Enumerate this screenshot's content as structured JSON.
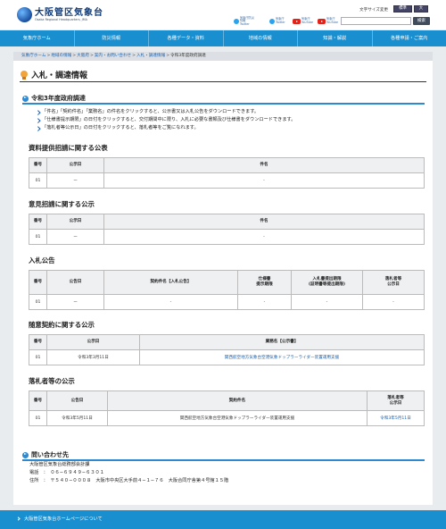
{
  "header": {
    "logo_ja": "大阪管区気象台",
    "logo_en": "Osaka Regional Headquarters, JMA",
    "sns": [
      {
        "icon": "twitter-icon",
        "label": "気象庁防災情報 Twitter"
      },
      {
        "icon": "twitter-icon",
        "label": "気象庁 Twitter"
      },
      {
        "icon": "youtube-icon",
        "label": "気象庁 YouTube"
      },
      {
        "icon": "youtube-icon",
        "label": "気象庁 YouTube"
      }
    ],
    "font_size_label": "文字サイズ変更",
    "font_size_standard": "標準",
    "font_size_large": "大",
    "search_button": "検索"
  },
  "nav": [
    "気象庁ホーム",
    "防災情報",
    "各種データ・資料",
    "地域の情報",
    "知識・解説",
    "各種申請・ご案内"
  ],
  "breadcrumbs": [
    "気象庁ホーム",
    "地域の情報",
    "大阪府",
    "案内・お問い合わせ",
    "入札・調達情報",
    "令和3年度政府調達"
  ],
  "page_title": "入札・調達情報",
  "section_title": "令和3年度政府調達",
  "notes": [
    "「件名」「契約件名」「業務名」の件名をクリックすると、公示書又は入札公告をダウンロードできます。",
    "「仕様書提示期限」の日付をクリックすると、交付期間中に限り、入札に必要な書類及び仕様書をダウンロードできます。",
    "「落札者等公示日」の日付をクリックすると、落札者等をご覧になれます。"
  ],
  "blocks": {
    "b1": {
      "title": "資料提供招請に関する公表",
      "headers": [
        "番号",
        "公示日",
        "件名"
      ],
      "rows": [
        [
          "01",
          "ー",
          "-"
        ]
      ]
    },
    "b2": {
      "title": "意見招請に関する公示",
      "headers": [
        "番号",
        "公示日",
        "件名"
      ],
      "rows": [
        [
          "01",
          "ー",
          "-"
        ]
      ]
    },
    "b3": {
      "title": "入札公告",
      "headers": [
        "番号",
        "公告日",
        "契約件名【入札公告】",
        "仕様書\n提示期限",
        "入札書提出期限\n(証明書等提出期限)",
        "落札者等\n公示日"
      ],
      "rows": [
        [
          "01",
          "ー",
          "-",
          "-",
          "-",
          "-"
        ]
      ]
    },
    "b4": {
      "title": "随意契約に関する公示",
      "headers": [
        "番号",
        "公示日",
        "業務名【公示書】"
      ],
      "rows": [
        [
          "01",
          "令和3年3月11日",
          "関西航空地方気象台空港気象ドップラーライダー装置運用支援"
        ]
      ]
    },
    "b5": {
      "title": "落札者等の公示",
      "headers": [
        "番号",
        "公告日",
        "契約件名",
        "落札者等\n公示日"
      ],
      "rows": [
        [
          "01",
          "令和3年5月11日",
          "関西航空地方気象台空港気象ドップラーライダー装置運用支援",
          "令和3年5月11日"
        ]
      ]
    }
  },
  "contact": {
    "title": "問い合わせ先",
    "org": "大阪管区気象台総務部会計課",
    "tel": "電話　：　０６−６９４９−６３０１",
    "address": "住所　：　〒５４０−０００８　大阪市中央区大手前４−１−７６　大阪合同庁舎第４号館１５階"
  },
  "footer": "大阪管区気象台ホームページについて",
  "colors": {
    "nav": "#1a8fd0",
    "accent": "#2e8ad0",
    "link": "#1a5fa8"
  }
}
